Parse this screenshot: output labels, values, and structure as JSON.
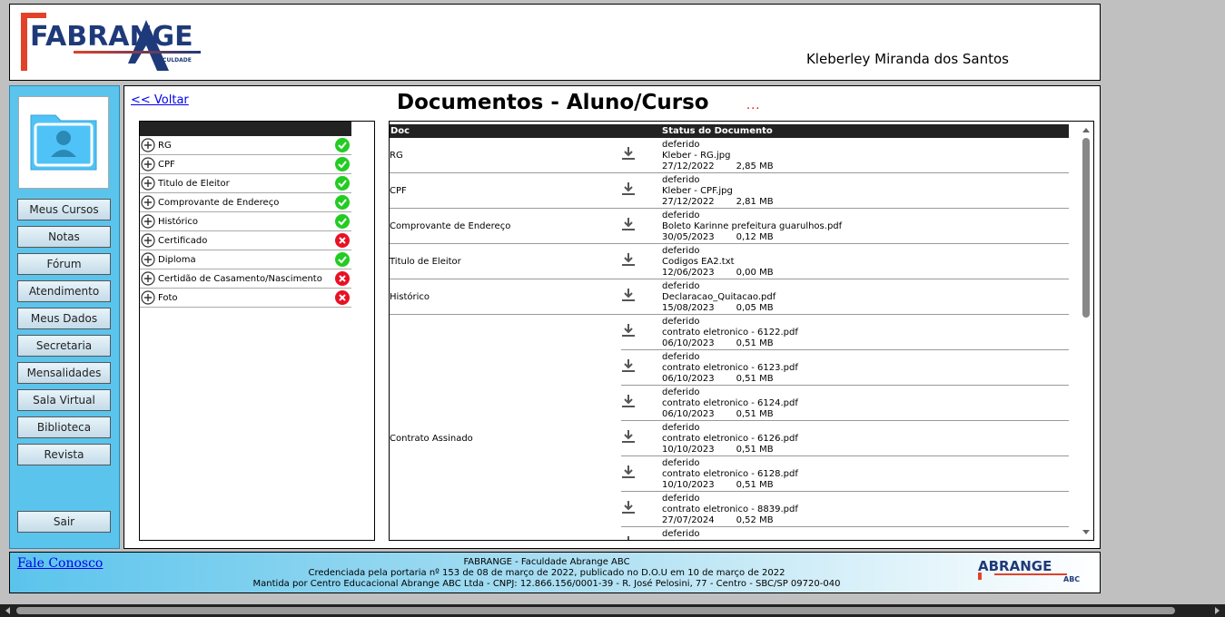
{
  "header": {
    "logo_text": "FABRANGE",
    "logo_sub": "FACULDADE",
    "user_name": "Kleberley Miranda dos Santos"
  },
  "sidebar": {
    "items": [
      {
        "label": "Meus Cursos"
      },
      {
        "label": "Notas"
      },
      {
        "label": "Fórum"
      },
      {
        "label": "Atendimento"
      },
      {
        "label": "Meus Dados"
      },
      {
        "label": "Secretaria"
      },
      {
        "label": "Mensalidades"
      },
      {
        "label": "Sala Virtual"
      },
      {
        "label": "Biblioteca"
      },
      {
        "label": "Revista"
      }
    ],
    "logout": "Sair"
  },
  "main": {
    "back": "<< Voltar",
    "title": "Documentos - Aluno/Curso",
    "dots": "..."
  },
  "checklist": [
    {
      "label": "RG",
      "ok": true
    },
    {
      "label": "CPF",
      "ok": true
    },
    {
      "label": "Titulo de Eleitor",
      "ok": true
    },
    {
      "label": "Comprovante de Endereço",
      "ok": true
    },
    {
      "label": "Histórico",
      "ok": true
    },
    {
      "label": "Certificado",
      "ok": false
    },
    {
      "label": "Diploma",
      "ok": true
    },
    {
      "label": "Certidão de Casamento/Nascimento",
      "ok": false
    },
    {
      "label": "Foto",
      "ok": false
    }
  ],
  "docs": {
    "col_doc": "Doc",
    "col_status": "Status do Documento",
    "groups": [
      {
        "name": "RG",
        "files": [
          {
            "status": "deferido",
            "file": "Kleber - RG.jpg",
            "date": "27/12/2022",
            "size": "2,85 MB"
          }
        ]
      },
      {
        "name": "CPF",
        "files": [
          {
            "status": "deferido",
            "file": "Kleber - CPF.jpg",
            "date": "27/12/2022",
            "size": "2,81 MB"
          }
        ]
      },
      {
        "name": "Comprovante de Endereço",
        "files": [
          {
            "status": "deferido",
            "file": "Boleto Karinne prefeitura guarulhos.pdf",
            "date": "30/05/2023",
            "size": "0,12 MB"
          }
        ]
      },
      {
        "name": "Titulo de Eleitor",
        "files": [
          {
            "status": "deferido",
            "file": "Codigos EA2.txt",
            "date": "12/06/2023",
            "size": "0,00 MB"
          }
        ]
      },
      {
        "name": "Histórico",
        "files": [
          {
            "status": "deferido",
            "file": "Declaracao_Quitacao.pdf",
            "date": "15/08/2023",
            "size": "0,05 MB"
          }
        ]
      },
      {
        "name": "Contrato Assinado",
        "files": [
          {
            "status": "deferido",
            "file": "contrato eletronico - 6122.pdf",
            "date": "06/10/2023",
            "size": "0,51 MB"
          },
          {
            "status": "deferido",
            "file": "contrato eletronico - 6123.pdf",
            "date": "06/10/2023",
            "size": "0,51 MB"
          },
          {
            "status": "deferido",
            "file": "contrato eletronico - 6124.pdf",
            "date": "06/10/2023",
            "size": "0,51 MB"
          },
          {
            "status": "deferido",
            "file": "contrato eletronico - 6126.pdf",
            "date": "10/10/2023",
            "size": "0,51 MB"
          },
          {
            "status": "deferido",
            "file": "contrato eletronico - 6128.pdf",
            "date": "10/10/2023",
            "size": "0,51 MB"
          },
          {
            "status": "deferido",
            "file": "contrato eletronico - 8839.pdf",
            "date": "27/07/2024",
            "size": "0,52 MB"
          },
          {
            "status": "deferido",
            "file": "",
            "date": "",
            "size": ""
          }
        ]
      }
    ]
  },
  "footer": {
    "contact": "Fale Conosco",
    "line1": "FABRANGE - Faculdade Abrange ABC",
    "line2": "Credenciada pela portaria nº 153 de 08 de março de 2022, publicado no D.O.U em 10 de março de 2022",
    "line3": "Mantida por Centro Educacional Abrange ABC Ltda - CNPJ: 12.866.156/0001-39 - R. José Pelosini, 77 - Centro - SBC/SP 09720-040",
    "abc_logo": "ABRANGE",
    "abc_sub": "ABC"
  },
  "colors": {
    "sidebar": "#5bc4ec",
    "ok": "#22cc22",
    "fail": "#e81123",
    "logo_blue": "#1f3a7a",
    "logo_red": "#e2412a"
  }
}
